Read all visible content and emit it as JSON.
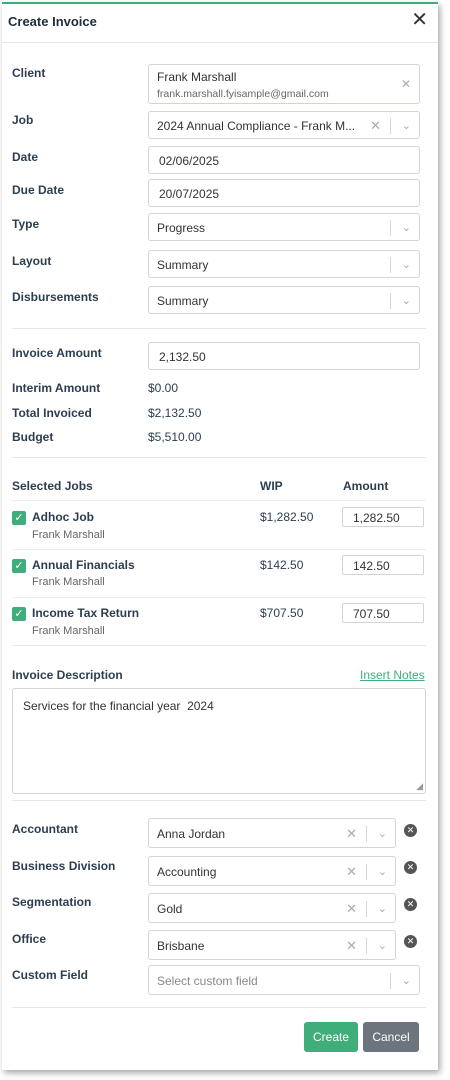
{
  "header": {
    "title": "Create Invoice"
  },
  "form": {
    "client_label": "Client",
    "client_name": "Frank Marshall",
    "client_email": "frank.marshall.fyisample@gmail.com",
    "job_label": "Job",
    "job_value": "2024 Annual Compliance - Frank M...",
    "date_label": "Date",
    "date_value": "02/06/2025",
    "due_date_label": "Due Date",
    "due_date_value": "20/07/2025",
    "type_label": "Type",
    "type_value": "Progress",
    "layout_label": "Layout",
    "layout_value": "Summary",
    "disbursements_label": "Disbursements",
    "disbursements_value": "Summary"
  },
  "amounts": {
    "invoice_amount_label": "Invoice Amount",
    "invoice_amount_value": "2,132.50",
    "interim_label": "Interim Amount",
    "interim_value": "$0.00",
    "total_invoiced_label": "Total Invoiced",
    "total_invoiced_value": "$2,132.50",
    "budget_label": "Budget",
    "budget_value": "$5,510.00"
  },
  "jobs": {
    "col_selected": "Selected Jobs",
    "col_wip": "WIP",
    "col_amount": "Amount",
    "rows": [
      {
        "name": "Adhoc Job",
        "client": "Frank Marshall",
        "wip": "$1,282.50",
        "amount": "1,282.50"
      },
      {
        "name": "Annual Financials",
        "client": "Frank Marshall",
        "wip": "$142.50",
        "amount": "142.50"
      },
      {
        "name": "Income Tax Return",
        "client": "Frank Marshall",
        "wip": "$707.50",
        "amount": "707.50"
      }
    ]
  },
  "description": {
    "label": "Invoice Description",
    "insert_notes": "Insert Notes",
    "text": "Services for the financial year  2024"
  },
  "extra": {
    "accountant_label": "Accountant",
    "accountant_value": "Anna Jordan",
    "division_label": "Business Division",
    "division_value": "Accounting",
    "segmentation_label": "Segmentation",
    "segmentation_value": "Gold",
    "office_label": "Office",
    "office_value": "Brisbane",
    "custom_label": "Custom Field",
    "custom_placeholder": "Select custom field"
  },
  "buttons": {
    "create": "Create",
    "cancel": "Cancel"
  },
  "colors": {
    "accent": "#3fae7a",
    "cancel": "#6c757d"
  }
}
